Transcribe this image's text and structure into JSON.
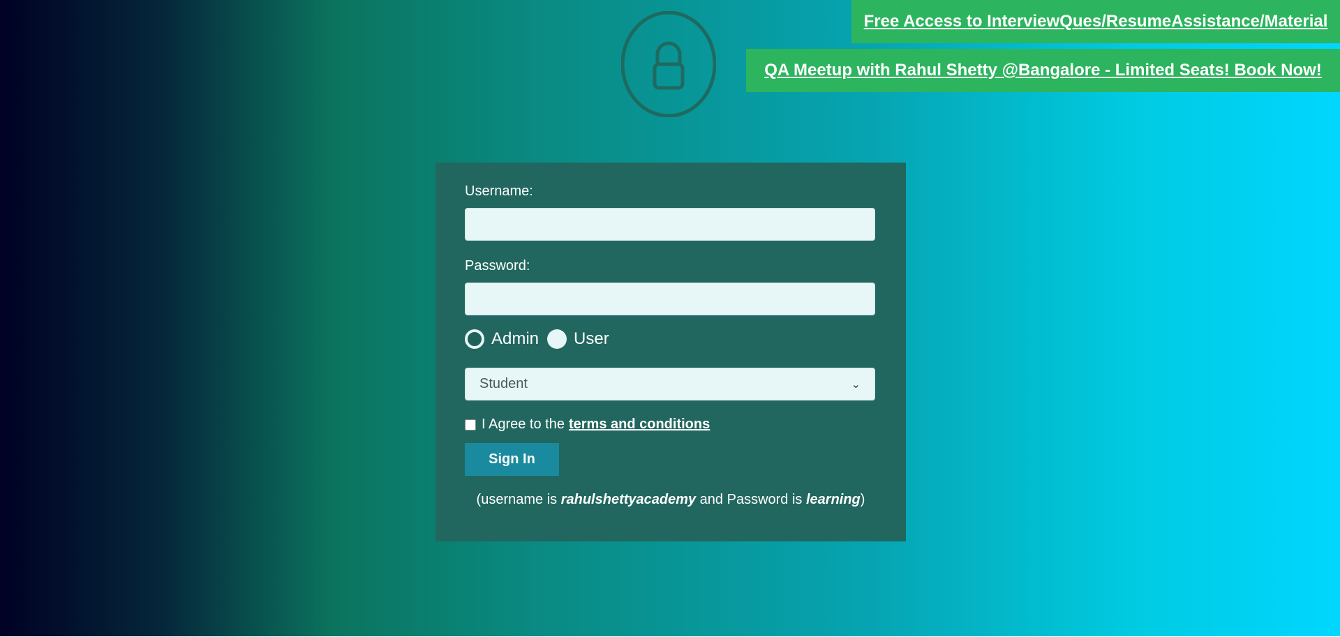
{
  "promos": {
    "top_link": "Free Access to InterviewQues/ResumeAssistance/Material",
    "second_link": "QA Meetup with Rahul Shetty @Bangalore - Limited Seats! Book Now!"
  },
  "icons": {
    "lock": "lock-icon"
  },
  "form": {
    "username_label": "Username:",
    "username_value": "",
    "password_label": "Password:",
    "password_value": "",
    "role_options": [
      {
        "label": "Admin",
        "selected": true
      },
      {
        "label": "User",
        "selected": false
      }
    ],
    "dropdown_selected": "Student",
    "terms_prefix": "I Agree to the",
    "terms_link": "terms and conditions",
    "terms_checked": false,
    "sign_in_label": "Sign In",
    "hint": {
      "open": "(username is ",
      "username": "rahulshettyacademy",
      "middle": " and Password is ",
      "password": "learning",
      "close": ")"
    }
  },
  "colors": {
    "promo_green": "#2cb45e",
    "panel_bg": "#21675f",
    "button_bg": "#1a8a9e",
    "field_bg": "#e7f6f6"
  }
}
